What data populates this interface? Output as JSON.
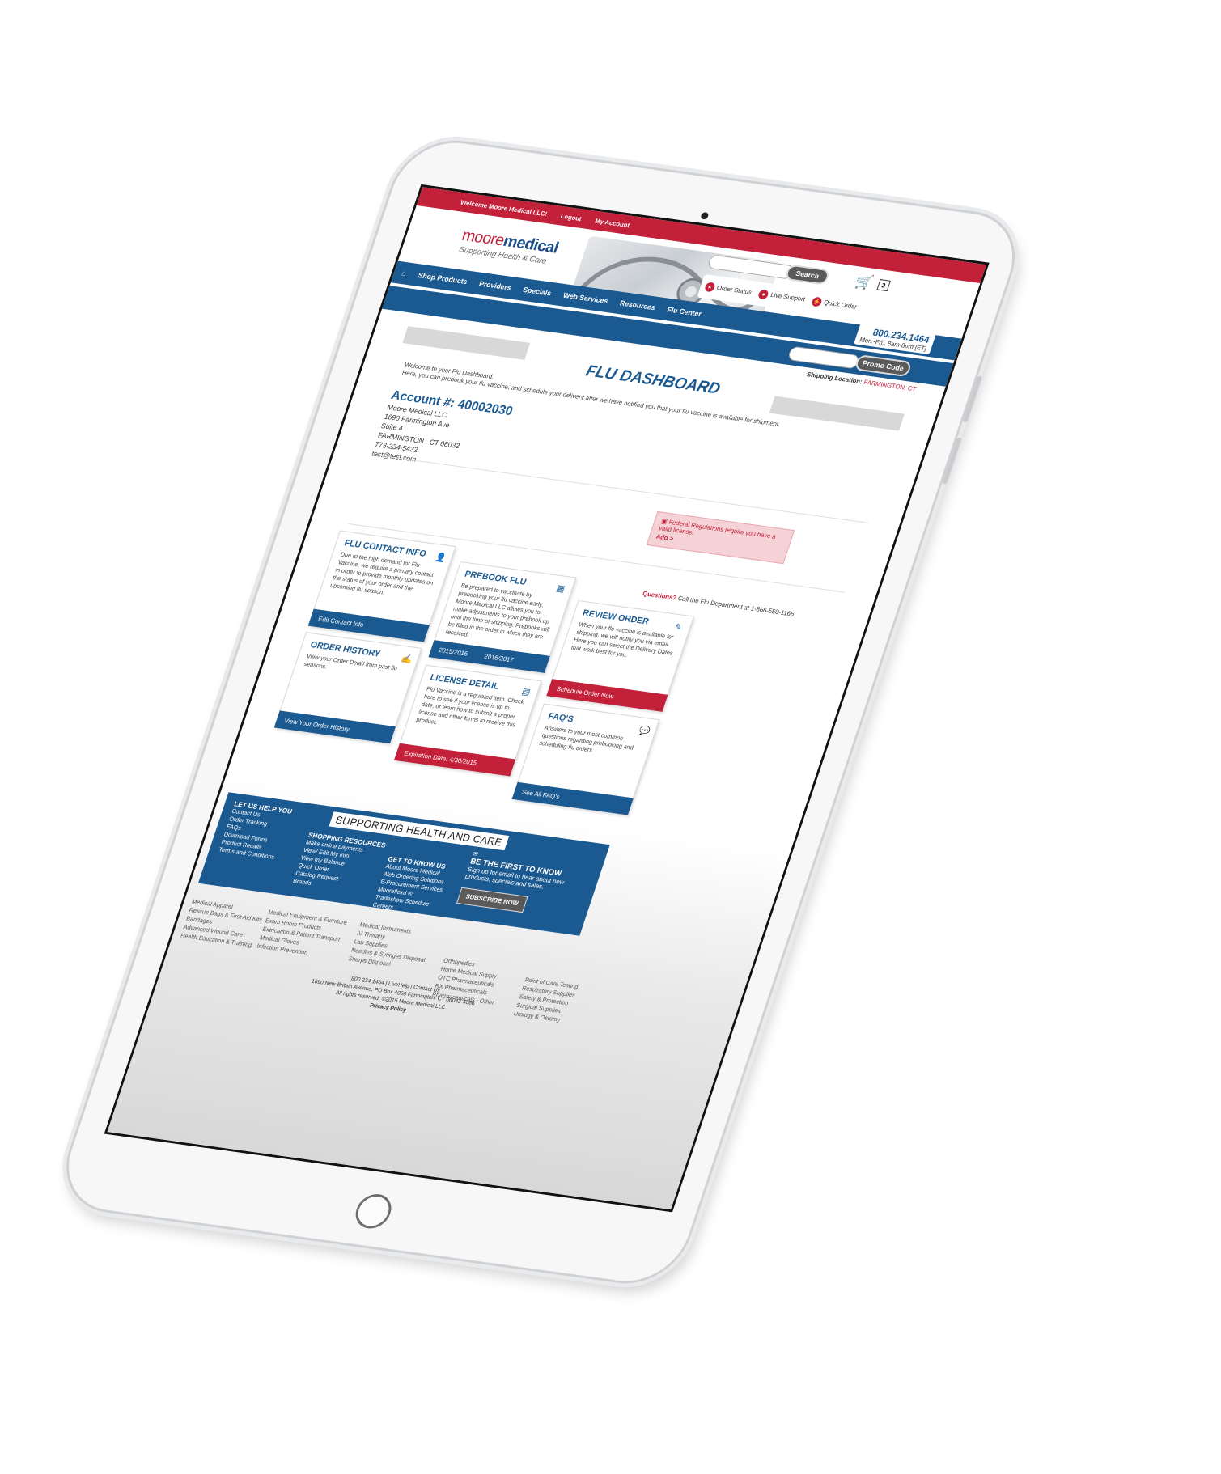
{
  "topbar": {
    "welcome": "Welcome Moore Medical LLC!",
    "logout": "Logout",
    "my_account": "My Account"
  },
  "header": {
    "logo_moore": "moore",
    "logo_medical": "medical",
    "tagline": "Supporting Health & Care",
    "search_button": "Search",
    "cart_count": "2",
    "order_status": "Order Status",
    "live_support": "Live Support",
    "quick_order": "Quick Order",
    "phone": "800.234.1464",
    "hours": "Mon.-Fri., 8am-8pm [ET]"
  },
  "nav": {
    "items": [
      "Shop Products",
      "Providers",
      "Specials",
      "Web Services",
      "Resources",
      "Flu Center"
    ]
  },
  "promo": {
    "button": "Promo Code",
    "ship_label": "Shipping Location:",
    "ship_value": "FARMINGTON, CT"
  },
  "dashboard": {
    "title": "FLU DASHBOARD",
    "intro_1": "Welcome to your Flu Dashboard.",
    "intro_2": "Here, you can prebook your flu vaccine, and schedule your delivery after we have notified you that your flu vaccine is available for shipment."
  },
  "account": {
    "number": "Account #: 40002030",
    "lines": [
      "Moore Medical LLC",
      "1690 Farmington Ave",
      "Suite 4",
      "FARMINGTON , CT   06032",
      "773-234-5432",
      "test@test.com"
    ]
  },
  "license_alert": {
    "text": "Federal Regulations require you have a valid license.",
    "link": "Add >"
  },
  "questions": {
    "label": "Questions?",
    "text": "Call the Flu Department at 1-866-550-1166"
  },
  "tiles": {
    "contact": {
      "title": "FLU CONTACT INFO",
      "body": "Due to the high demand for Flu Vaccine, we require a primary contact in order to provide monthly updates on the status of your order and the upcoming flu season.",
      "footer": "Edit Contact Info"
    },
    "prebook": {
      "title": "PREBOOK FLU",
      "body": "Be prepared to vaccinate by prebooking your flu vaccine early. Moore Medical LLC allows you to make adjustments to your prebook up until the time of shipping. Prebooks will be filled in the order in which they are received.",
      "footer_a": "2015/2016",
      "footer_b": "2016/2017"
    },
    "review": {
      "title": "REVIEW ORDER",
      "body": "When your flu vaccine is available for shipping, we will notify you via email. Here you can select the Delivery Dates that work best for you.",
      "footer": "Schedule Order Now"
    },
    "history": {
      "title": "ORDER HISTORY",
      "body": "View your Order Detail from past flu seasons.",
      "footer": "View Your Order History"
    },
    "license": {
      "title": "LICENSE DETAIL",
      "body": "Flu Vaccine is a regulated item. Check here to see if your license is up to date, or learn how to submit a proper license and other forms to receive this product.",
      "footer": "Expiration Date: 4/30/2015"
    },
    "faq": {
      "title": "FAQ'S",
      "body": "Answers to your most common questions regarding prebooking and scheduling flu orders",
      "footer": "See All FAQ's"
    }
  },
  "footer": {
    "heading": "SUPPORTING HEALTH AND CARE",
    "help": {
      "title": "LET US HELP YOU",
      "links": [
        "Contact Us",
        "Order Tracking",
        "FAQs",
        "Download Forms",
        "Product Recalls",
        "Terms and Conditions"
      ]
    },
    "shopping": {
      "title": "SHOPPING RESOURCES",
      "links": [
        "Make online payments",
        "View/ Edit My Info",
        "View my Balance",
        "Quick Order",
        "Catalog Request",
        "Brands"
      ]
    },
    "know": {
      "title": "GET TO KNOW US",
      "links": [
        "About Moore Medical",
        "Web Ordering Solutions",
        "E-Procurement Services",
        "Mooreflexd ®",
        "Tradeshow Schedule",
        "Careers"
      ]
    },
    "first": {
      "title": "BE THE FIRST TO KNOW",
      "text": "Sign up for email to hear about new products, specials and sales.",
      "button": "SUBSCRIBE NOW"
    },
    "cats_1": [
      "Medical Apparel",
      "Rescue Bags & First Aid Kits",
      "Bandages",
      "Advanced Wound Care",
      "Health Education & Training"
    ],
    "cats_2": [
      "Medical Equipment & Furniture",
      "Exam Room Products",
      "Extrication & Patient Transport",
      "Medical Gloves",
      "Infection Prevention"
    ],
    "cats_3": [
      "Medical Instruments",
      "IV Therapy",
      "Lab Supplies",
      "Needles & Syringes Disposal",
      "Sharps Disposal"
    ],
    "cats_4": [
      "Orthopedics",
      "Home Medical Supply",
      "OTC Pharmaceuticals",
      "RX Pharmaceuticals",
      "Pharmaceuticals - Other"
    ],
    "cats_5": [
      "Point of Care Testing",
      "Respiratory Supplies",
      "Safety & Protection",
      "Surgical Supplies",
      "Urology & Ostomy"
    ],
    "legal_1": "800.234.1464 | LiveHelp | Contact Us",
    "legal_2": "1690 New Britain Avenue, PO Box 4066 Farmington, CT 06032-4066",
    "legal_3": "All rights reserved. ©2015 Moore Medical LLC",
    "legal_4": "Privacy Policy"
  }
}
